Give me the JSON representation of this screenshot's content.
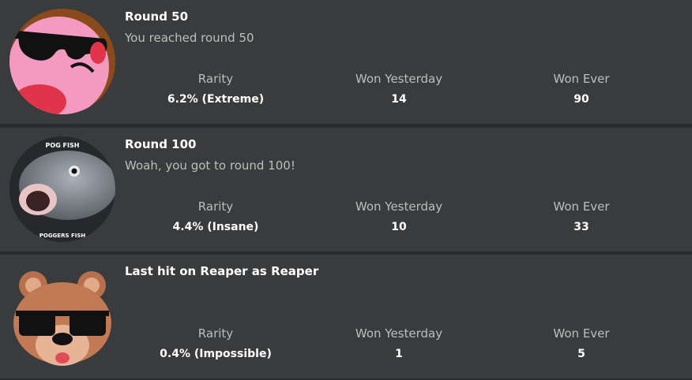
{
  "labels": {
    "rarity": "Rarity",
    "won_yesterday": "Won Yesterday",
    "won_ever": "Won Ever"
  },
  "badges": [
    {
      "title": "Round 50",
      "description": "You reached round 50",
      "rarity": "6.2% (Extreme)",
      "won_yesterday": "14",
      "won_ever": "90",
      "icon": "pink-face-sunglasses-icon"
    },
    {
      "title": "Round 100",
      "description": "Woah, you got to round 100!",
      "rarity": "4.4% (Insane)",
      "won_yesterday": "10",
      "won_ever": "33",
      "icon": "pog-fish-icon",
      "icon_text_top": "POG FISH",
      "icon_text_bottom": "POGGERS FISH"
    },
    {
      "title": "Last hit on Reaper as Reaper",
      "description": "",
      "rarity": "0.4% (Impossible)",
      "won_yesterday": "1",
      "won_ever": "5",
      "icon": "bear-sunglasses-icon"
    }
  ]
}
